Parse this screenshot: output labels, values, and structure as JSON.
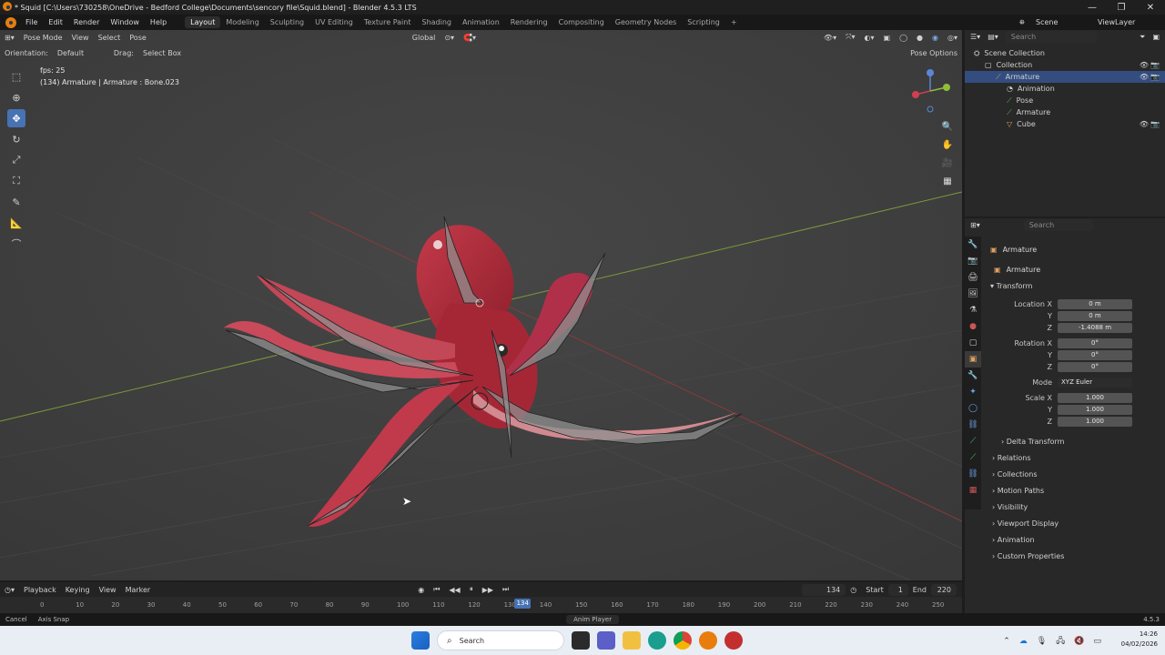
{
  "window": {
    "title": "* Squid [C:\\Users\\730258\\OneDrive - Bedford College\\Documents\\sencory file\\Squid.blend] - Blender 4.5.3 LTS"
  },
  "menu": [
    "File",
    "Edit",
    "Render",
    "Window",
    "Help"
  ],
  "workspaces": [
    "Layout",
    "Modeling",
    "Sculpting",
    "UV Editing",
    "Texture Paint",
    "Shading",
    "Animation",
    "Rendering",
    "Compositing",
    "Geometry Nodes",
    "Scripting"
  ],
  "active_workspace": "Layout",
  "scene": {
    "label": "Scene",
    "view_layer": "ViewLayer"
  },
  "viewport": {
    "mode": "Pose Mode",
    "menus": [
      "View",
      "Select",
      "Pose"
    ],
    "orientation_label": "Orientation:",
    "orientation_value": "Default",
    "drag_label": "Drag:",
    "drag_value": "Select Box",
    "transform_orientation": "Global",
    "pose_options": "Pose Options",
    "fps": "fps: 25",
    "info": "(134) Armature | Armature : Bone.023"
  },
  "timeline": {
    "menus": [
      "Playback",
      "Keying",
      "View",
      "Marker"
    ],
    "current_frame": "134",
    "start_label": "Start",
    "start": "1",
    "end_label": "End",
    "end": "220",
    "ticks": [
      "0",
      "10",
      "20",
      "30",
      "40",
      "50",
      "60",
      "70",
      "80",
      "90",
      "100",
      "110",
      "120",
      "130",
      "140",
      "150",
      "160",
      "170",
      "180",
      "190",
      "200",
      "210",
      "220",
      "230",
      "240",
      "250"
    ]
  },
  "status": {
    "cancel": "Cancel",
    "axis_snap": "Axis Snap",
    "center": "Anim Player",
    "version": "4.5.3"
  },
  "outliner": {
    "search_placeholder": "Search",
    "items": [
      {
        "label": "Scene Collection",
        "indent": 0
      },
      {
        "label": "Collection",
        "indent": 1
      },
      {
        "label": "Armature",
        "indent": 2,
        "selected": true
      },
      {
        "label": "Animation",
        "indent": 3
      },
      {
        "label": "Pose",
        "indent": 3
      },
      {
        "label": "Armature",
        "indent": 3
      },
      {
        "label": "Cube",
        "indent": 3
      }
    ]
  },
  "properties": {
    "search_placeholder": "Search",
    "object_name": "Armature",
    "data_name": "Armature",
    "transform_label": "Transform",
    "location_label": "Location X",
    "location": [
      "0 m",
      "0 m",
      "-1.4088 m"
    ],
    "rotation_label": "Rotation X",
    "rotation": [
      "0°",
      "0°",
      "0°"
    ],
    "mode_label": "Mode",
    "mode_value": "XYZ Euler",
    "scale_label": "Scale X",
    "scale": [
      "1.000",
      "1.000",
      "1.000"
    ],
    "axis_y": "Y",
    "axis_z": "Z",
    "sections": [
      "Delta Transform",
      "Relations",
      "Collections",
      "Motion Paths",
      "Visibility",
      "Viewport Display",
      "Animation",
      "Custom Properties"
    ]
  },
  "taskbar": {
    "search": "Search",
    "time": "14:26",
    "date": "04/02/2026"
  },
  "colors": {
    "accent": "#4772b3",
    "squid": "#b8333d",
    "viewport_bg": "#3d3d3d"
  }
}
